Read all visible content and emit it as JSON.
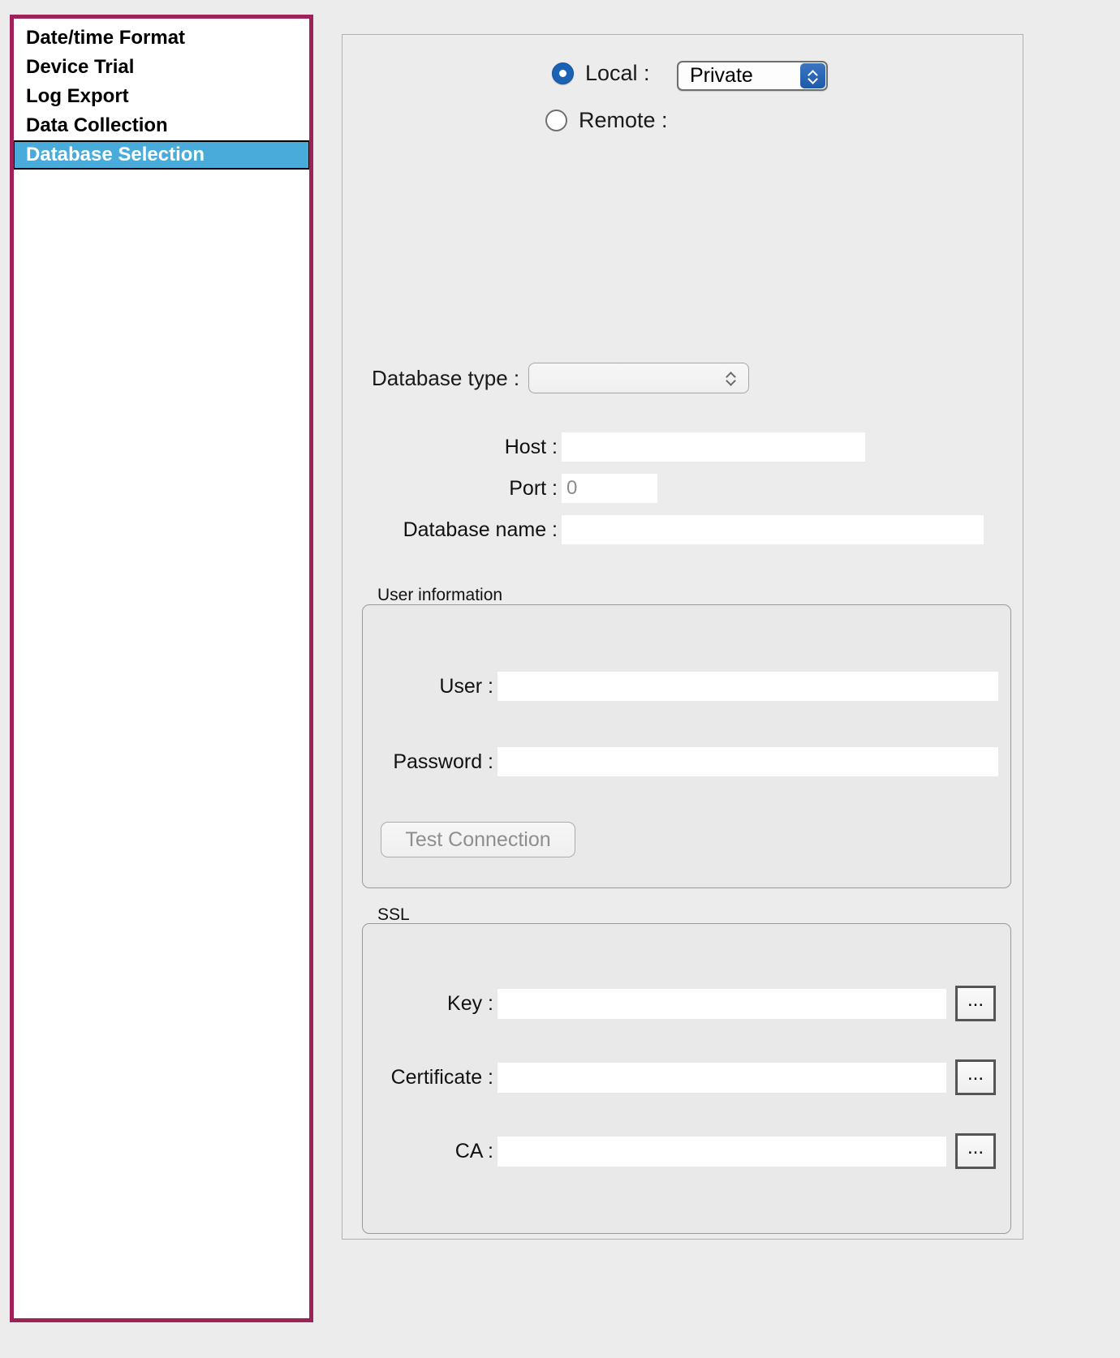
{
  "sidebar": {
    "items": [
      {
        "label": "Date/time Format",
        "selected": false
      },
      {
        "label": "Device Trial",
        "selected": false
      },
      {
        "label": "Log Export",
        "selected": false
      },
      {
        "label": "Data Collection",
        "selected": false
      },
      {
        "label": "Database Selection",
        "selected": true
      }
    ],
    "border_color": "#9e2158",
    "selection_color": "#49abd9"
  },
  "panel": {
    "mode": {
      "local": {
        "label": "Local :",
        "selected": true,
        "select_value": "Private",
        "options": [
          "Private"
        ]
      },
      "remote": {
        "label": "Remote :",
        "selected": false
      }
    },
    "database_type": {
      "label": "Database type :",
      "value": "",
      "options": []
    },
    "connection": {
      "host": {
        "label": "Host :",
        "value": "",
        "placeholder": ""
      },
      "port": {
        "label": "Port :",
        "value": "",
        "placeholder": "0"
      },
      "database_name": {
        "label": "Database name :",
        "value": "",
        "placeholder": ""
      }
    },
    "user_information": {
      "title": "User information",
      "user": {
        "label": "User :",
        "value": "",
        "placeholder": ""
      },
      "password": {
        "label": "Password :",
        "value": "",
        "placeholder": ""
      },
      "test_connection_label": "Test Connection",
      "test_connection_enabled": false
    },
    "ssl": {
      "title": "SSL",
      "key": {
        "label": "Key :",
        "value": "",
        "placeholder": "",
        "browse_label": "..."
      },
      "certificate": {
        "label": "Certificate :",
        "value": "",
        "placeholder": "",
        "browse_label": "..."
      },
      "ca": {
        "label": "CA :",
        "value": "",
        "placeholder": "",
        "browse_label": "..."
      }
    }
  }
}
